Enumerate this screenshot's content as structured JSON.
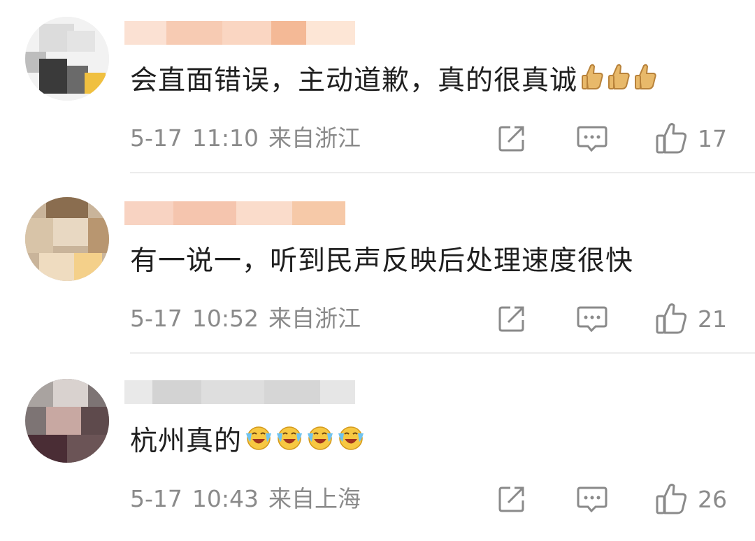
{
  "comments": [
    {
      "text": "会直面错误，主动道歉，真的很真诚",
      "emoji": [
        "thumbs-up-icon",
        "thumbs-up-icon",
        "thumbs-up-icon"
      ],
      "date": "5-17",
      "time": "11:10",
      "location": "来自浙江",
      "likes": "17"
    },
    {
      "text": "有一说一，听到民声反映后处理速度很快",
      "emoji": [],
      "date": "5-17",
      "time": "10:52",
      "location": "来自浙江",
      "likes": "21"
    },
    {
      "text": "杭州真的",
      "emoji": [
        "crying-laughing-icon",
        "crying-laughing-icon",
        "crying-laughing-icon",
        "crying-laughing-icon"
      ],
      "date": "5-17",
      "time": "10:43",
      "location": "来自上海",
      "likes": "26"
    }
  ],
  "colors": {
    "text": "#1f1f1f",
    "meta": "#8a8a8a",
    "icon": "#8a8a8a",
    "divider": "#ececec",
    "thumb": "#e8b96a"
  }
}
